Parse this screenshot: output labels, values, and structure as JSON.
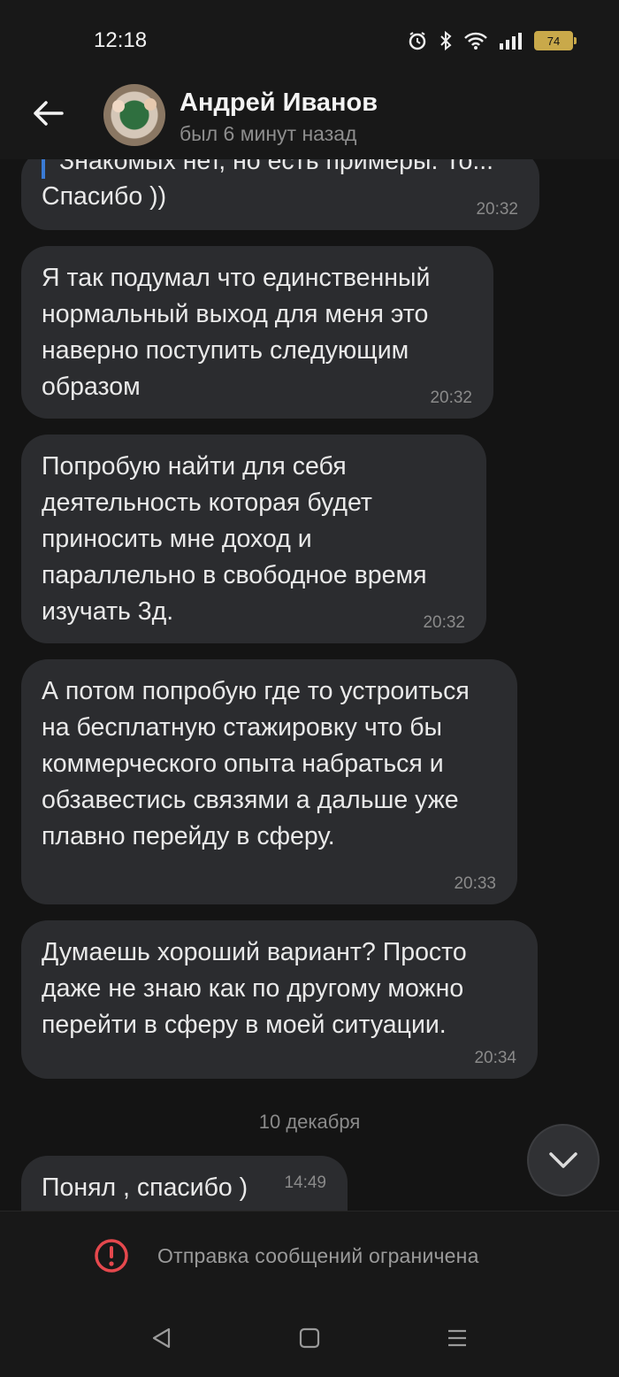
{
  "status_bar": {
    "time": "12:18",
    "battery": "74"
  },
  "header": {
    "contact_name": "Андрей Иванов",
    "contact_status": "был 6 минут назад"
  },
  "messages": [
    {
      "quote": "Знакомых нет, но есть примеры. То...",
      "text": "Спасибо ))",
      "time": "20:32"
    },
    {
      "text": "Я так подумал что единственный нормальный выход для меня это наверно поступить следующим образом",
      "time": "20:32"
    },
    {
      "text": "Попробую найти для себя деятельность которая будет приносить мне доход и параллельно в свободное время изучать 3д.",
      "time": "20:32"
    },
    {
      "text": "А потом попробую где то устроиться на бесплатную стажировку что бы коммерческого опыта набраться и обзавестись связями а дальше уже плавно перейду в сферу.",
      "time": "20:33"
    },
    {
      "text": "Думаешь хороший вариант? Просто даже не знаю как по другому можно перейти в сферу в моей ситуации.",
      "time": "20:34"
    },
    {
      "text": "Понял , спасибо )",
      "time": "14:49"
    }
  ],
  "date_separator": "10 декабря",
  "footer": {
    "restriction_text": "Отправка сообщений ограничена"
  },
  "icons": {
    "back": "arrow-left-icon",
    "scroll": "chevron-down-icon",
    "restriction": "exclamation-circle-icon",
    "nav": [
      "back-triangle-icon",
      "home-square-icon",
      "menu-lines-icon"
    ]
  },
  "colors": {
    "background": "#141414",
    "bubble": "#2b2c2f",
    "accent": "#3a7bd5",
    "warning": "#e5484d"
  }
}
